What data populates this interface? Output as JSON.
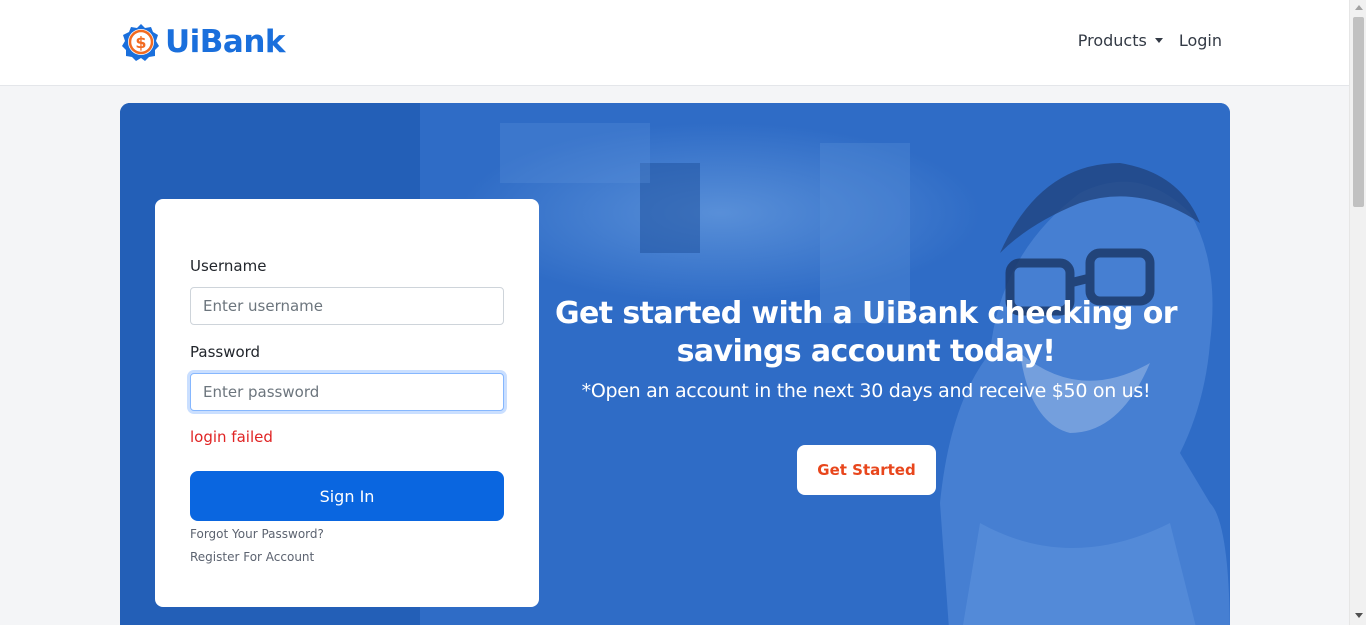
{
  "brand": {
    "name": "UiBank",
    "color": "#1a6fdc",
    "accent_color": "#f26b21"
  },
  "nav": {
    "products_label": "Products",
    "login_label": "Login"
  },
  "login_form": {
    "username_label": "Username",
    "username_placeholder": "Enter username",
    "username_value": "",
    "password_label": "Password",
    "password_placeholder": "Enter password",
    "password_value": "",
    "error_message": "login failed",
    "signin_label": "Sign In",
    "forgot_password_label": "Forgot Your Password?",
    "register_label": "Register For Account"
  },
  "hero": {
    "heading_line1": "Get started with a UiBank checking or",
    "heading_line2": "savings account today!",
    "subheading": "*Open an account in the next 30 days and receive $50 on us!",
    "cta_label": "Get Started"
  },
  "colors": {
    "primary": "#0a66e0",
    "error": "#e02424",
    "cta_text": "#e8461c"
  }
}
